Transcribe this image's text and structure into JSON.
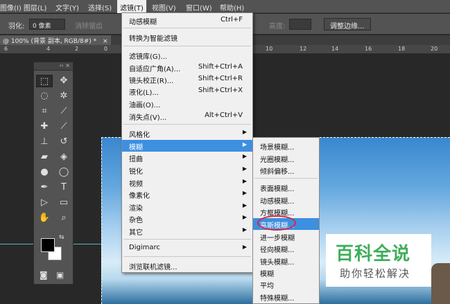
{
  "menubar": {
    "items": [
      "图像(I)",
      "图层(L)",
      "文字(Y)",
      "选择(S)",
      "滤镜(T)",
      "视图(V)",
      "窗口(W)",
      "帮助(H)"
    ]
  },
  "options": {
    "feather_label": "羽化:",
    "feather_value": "0 像素",
    "antialias_label": "消除锯齿",
    "height_label": "高度:",
    "refine_button": "调整边缘..."
  },
  "document_tab": {
    "title": "@ 100% (背景 副本, RGB/8#) *",
    "close": "×"
  },
  "ruler": {
    "ticks": [
      "6",
      "4",
      "2",
      "0",
      "10",
      "12",
      "14",
      "16",
      "18",
      "20"
    ]
  },
  "toolbox": {
    "header_icons": "‹‹ ×"
  },
  "filter_menu": {
    "items": [
      {
        "label": "动感模糊",
        "shortcut": "Ctrl+F"
      },
      {
        "label": "转换为智能滤镜",
        "shortcut": ""
      },
      {
        "label": "滤镜库(G)...",
        "shortcut": ""
      },
      {
        "label": "自适应广角(A)...",
        "shortcut": "Shift+Ctrl+A"
      },
      {
        "label": "镜头校正(R)...",
        "shortcut": "Shift+Ctrl+R"
      },
      {
        "label": "液化(L)...",
        "shortcut": "Shift+Ctrl+X"
      },
      {
        "label": "油画(O)...",
        "shortcut": ""
      },
      {
        "label": "消失点(V)...",
        "shortcut": "Alt+Ctrl+V"
      },
      {
        "label": "风格化",
        "shortcut": ""
      },
      {
        "label": "模糊",
        "shortcut": ""
      },
      {
        "label": "扭曲",
        "shortcut": ""
      },
      {
        "label": "锐化",
        "shortcut": ""
      },
      {
        "label": "视频",
        "shortcut": ""
      },
      {
        "label": "像素化",
        "shortcut": ""
      },
      {
        "label": "渲染",
        "shortcut": ""
      },
      {
        "label": "杂色",
        "shortcut": ""
      },
      {
        "label": "其它",
        "shortcut": ""
      },
      {
        "label": "Digimarc",
        "shortcut": ""
      },
      {
        "label": "浏览联机滤镜...",
        "shortcut": ""
      }
    ]
  },
  "blur_menu": {
    "items": [
      "场景模糊...",
      "光圈模糊...",
      "倾斜偏移...",
      "表面模糊...",
      "动感模糊...",
      "方框模糊...",
      "高斯模糊...",
      "进一步模糊",
      "径向模糊...",
      "镜头模糊...",
      "模糊",
      "平均",
      "特殊模糊..."
    ]
  },
  "watermark": {
    "title": "百科全说",
    "subtitle": "助你轻松解决"
  }
}
